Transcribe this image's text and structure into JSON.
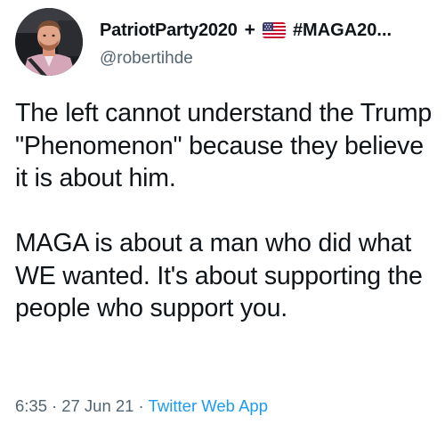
{
  "author": {
    "display_name": "PatriotParty2020",
    "plus": "+",
    "flag_icon": "us-flag-icon",
    "hashtag": "#MAGA20...",
    "handle": "@robertihde"
  },
  "tweet": {
    "paragraph_1": "The left cannot understand the Trump \"Phenomenon\" because they believe it is about him.",
    "paragraph_2": "MAGA is about a man who did what WE wanted. It's about supporting the people who support you."
  },
  "meta": {
    "time": "6:35",
    "separator": "·",
    "date": "27 Jun 21",
    "source": "Twitter Web App"
  },
  "colors": {
    "text": "#0f1419",
    "secondary": "#536471",
    "link": "#1d9bf0"
  }
}
